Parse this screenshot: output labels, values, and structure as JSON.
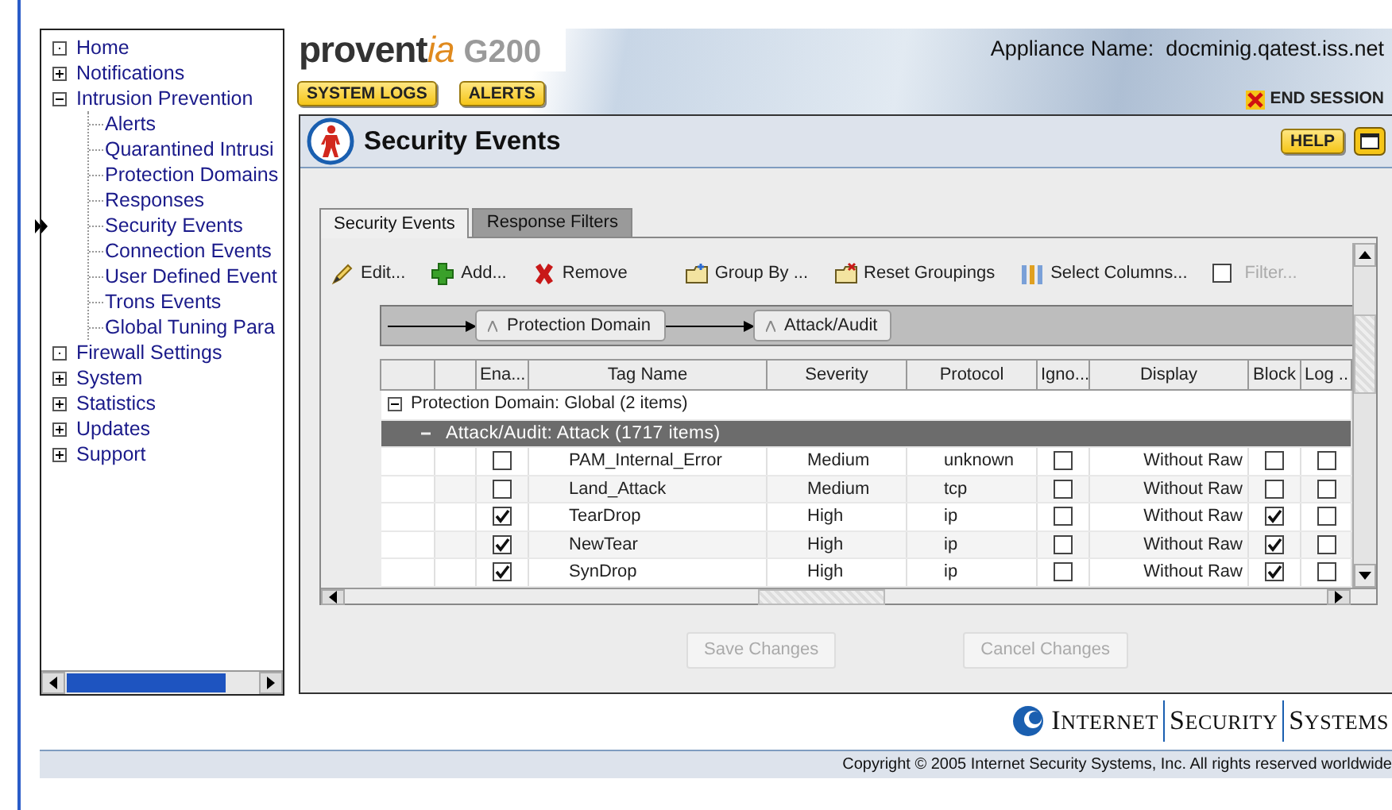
{
  "sidebar": {
    "items": [
      {
        "label": "Home",
        "kind": "leaf",
        "selected": false
      },
      {
        "label": "Notifications",
        "kind": "collapsed",
        "selected": false
      },
      {
        "label": "Intrusion Prevention",
        "kind": "expanded",
        "selected": false,
        "children": [
          {
            "label": "Alerts",
            "selected": false
          },
          {
            "label": "Quarantined Intrusi",
            "selected": false
          },
          {
            "label": "Protection Domains",
            "selected": false
          },
          {
            "label": "Responses",
            "selected": false
          },
          {
            "label": "Security Events",
            "selected": true
          },
          {
            "label": "Connection Events",
            "selected": false
          },
          {
            "label": "User Defined Event",
            "selected": false
          },
          {
            "label": "Trons Events",
            "selected": false
          },
          {
            "label": "Global Tuning Para",
            "selected": false
          }
        ]
      },
      {
        "label": "Firewall Settings",
        "kind": "leaf",
        "selected": false
      },
      {
        "label": "System",
        "kind": "collapsed",
        "selected": false
      },
      {
        "label": "Statistics",
        "kind": "collapsed",
        "selected": false
      },
      {
        "label": "Updates",
        "kind": "collapsed",
        "selected": false
      },
      {
        "label": "Support",
        "kind": "collapsed",
        "selected": false
      }
    ]
  },
  "header": {
    "logo": "provent",
    "logo_accent": "ia",
    "model": "G200",
    "appliance_name": "Appliance Name:  docminig.qatest.iss.net",
    "buttons": [
      "SYSTEM LOGS",
      "ALERTS"
    ],
    "end_session": "END SESSION"
  },
  "panel": {
    "title": "Security Events",
    "help": "HELP",
    "tabs": [
      {
        "label": "Security Events",
        "selected": true
      },
      {
        "label": "Response Filters",
        "selected": false
      }
    ],
    "toolbar": [
      {
        "kind": "edit",
        "label": "Edit..."
      },
      {
        "kind": "add",
        "label": "Add..."
      },
      {
        "kind": "remove",
        "label": "Remove"
      },
      {
        "kind": "group",
        "label": "Group By ..."
      },
      {
        "kind": "reset",
        "label": "Reset Groupings"
      },
      {
        "kind": "columns",
        "label": "Select Columns..."
      }
    ],
    "filter": {
      "checked": false,
      "placeholder": "Filter..."
    },
    "groupings": [
      "Protection Domain",
      "Attack/Audit"
    ],
    "table": {
      "columns": [
        "Ena...",
        "Tag Name",
        "Severity",
        "Protocol",
        "Igno...",
        "Display",
        "Block",
        "Log .."
      ],
      "group": {
        "label": "Protection Domain: Global (2 items)",
        "expanded": true
      },
      "subgroup": {
        "label": "Attack/Audit: Attack (1717 items)",
        "expanded": true
      },
      "rows": [
        {
          "enabled": false,
          "tag": "PAM_Internal_Error",
          "severity": "Medium",
          "protocol": "unknown",
          "ignore": false,
          "display": "Without Raw",
          "block": false,
          "log": false
        },
        {
          "enabled": false,
          "tag": "Land_Attack",
          "severity": "Medium",
          "protocol": "tcp",
          "ignore": false,
          "display": "Without Raw",
          "block": false,
          "log": false
        },
        {
          "enabled": true,
          "tag": "TearDrop",
          "severity": "High",
          "protocol": "ip",
          "ignore": false,
          "display": "Without Raw",
          "block": true,
          "log": false
        },
        {
          "enabled": true,
          "tag": "NewTear",
          "severity": "High",
          "protocol": "ip",
          "ignore": false,
          "display": "Without Raw",
          "block": true,
          "log": false
        },
        {
          "enabled": true,
          "tag": "SynDrop",
          "severity": "High",
          "protocol": "ip",
          "ignore": false,
          "display": "Without Raw",
          "block": true,
          "log": false
        }
      ]
    },
    "actions": [
      {
        "label": "Save Changes",
        "disabled": true
      },
      {
        "label": "Cancel Changes",
        "disabled": true
      }
    ]
  },
  "footer": {
    "brand": [
      "INTERNET",
      "SECURITY",
      "SYSTEMS"
    ],
    "copyright": "Copyright © 2005 Internet Security Systems, Inc. All rights reserved worldwide"
  }
}
